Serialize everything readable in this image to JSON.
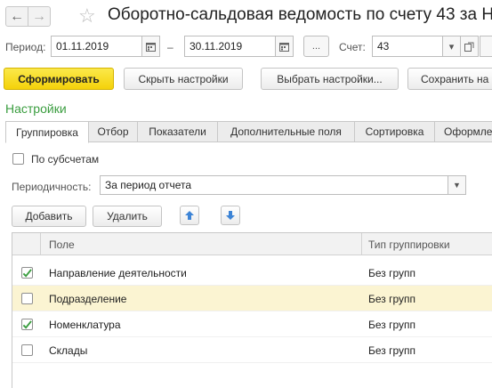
{
  "window": {
    "title": "Оборотно-сальдовая ведомость по счету 43 за Н"
  },
  "period": {
    "label": "Период:",
    "from": "01.11.2019",
    "separator": "–",
    "to": "30.11.2019",
    "more_label": "..."
  },
  "account": {
    "label": "Счет:",
    "value": "43"
  },
  "toolbar": {
    "generate": "Сформировать",
    "hide_settings": "Скрыть настройки",
    "choose_settings": "Выбрать настройки...",
    "save_settings": "Сохранить на"
  },
  "settings": {
    "title": "Настройки",
    "tabs": [
      {
        "label": "Группировка",
        "active": true
      },
      {
        "label": "Отбор"
      },
      {
        "label": "Показатели"
      },
      {
        "label": "Дополнительные поля"
      },
      {
        "label": "Сортировка"
      },
      {
        "label": "Оформле"
      }
    ],
    "by_subaccounts": {
      "label": "По субсчетам",
      "checked": false
    },
    "periodicity": {
      "label": "Периодичность:",
      "value": "За период отчета"
    },
    "add_label": "Добавить",
    "delete_label": "Удалить",
    "grid": {
      "headers": {
        "field": "Поле",
        "type": "Тип группировки"
      },
      "rows": [
        {
          "checked": true,
          "name": "Направление деятельности",
          "type": "Без групп",
          "selected": false
        },
        {
          "checked": false,
          "name": "Подразделение",
          "type": "Без групп",
          "selected": true
        },
        {
          "checked": true,
          "name": "Номенклатура",
          "type": "Без групп",
          "selected": false
        },
        {
          "checked": false,
          "name": "Склады",
          "type": "Без групп",
          "selected": false
        }
      ]
    }
  },
  "colors": {
    "accent_green": "#3a9d3f",
    "primary_button": "#f4d20a",
    "selected_row": "#fbf4d2",
    "arrow_blue": "#3d84d6"
  }
}
